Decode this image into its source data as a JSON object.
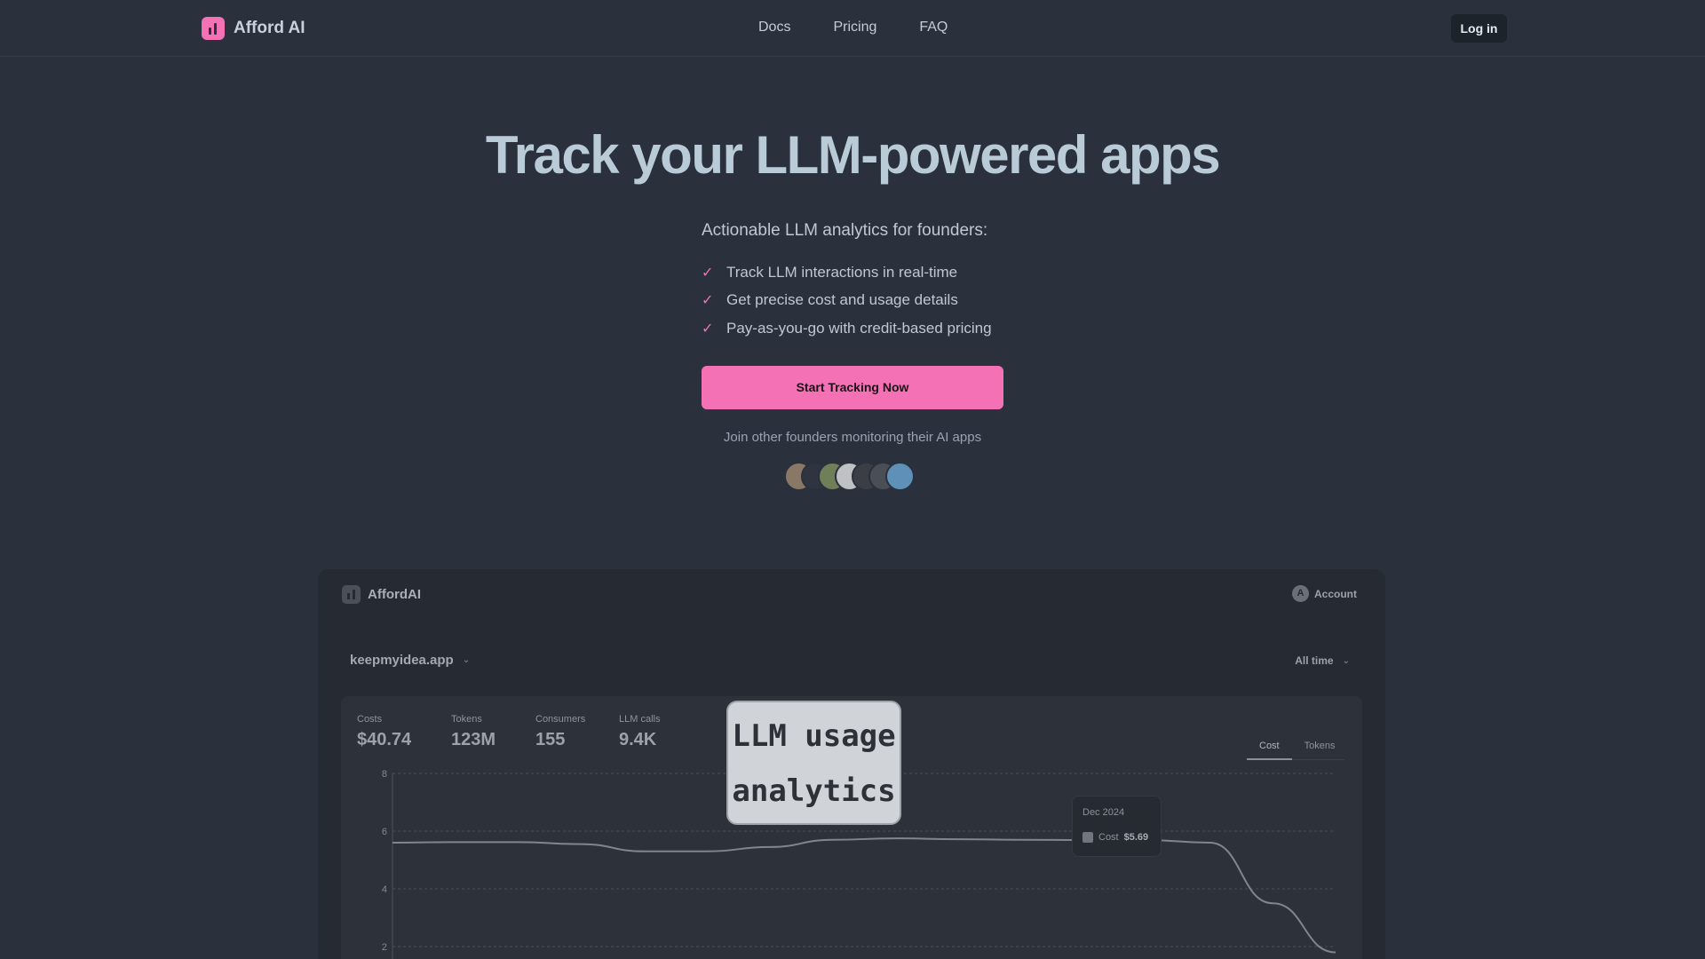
{
  "nav": {
    "brand": "Afford AI",
    "links": [
      "Docs",
      "Pricing",
      "FAQ"
    ],
    "login": "Log in"
  },
  "hero": {
    "title": "Track your LLM-powered apps",
    "subtitle": "Actionable LLM analytics for founders:",
    "features": [
      "Track LLM interactions in real-time",
      "Get precise cost and usage details",
      "Pay-as-you-go with credit-based pricing"
    ],
    "cta": "Start Tracking Now",
    "join_text": "Join other founders monitoring their AI apps",
    "avatar_colors": [
      "#8a7866",
      "#2f3440",
      "#6f7f58",
      "#bfc1c4",
      "#3b3f45",
      "#4a4e55",
      "#5f91b8"
    ]
  },
  "dashboard": {
    "brand": "AffordAI",
    "account": "Account",
    "account_initial": "A",
    "project": "keepmyidea.app",
    "time_range": "All time",
    "stats": [
      {
        "label": "Costs",
        "value": "$40.74"
      },
      {
        "label": "Tokens",
        "value": "123M"
      },
      {
        "label": "Consumers",
        "value": "155"
      },
      {
        "label": "LLM calls",
        "value": "9.4K"
      }
    ],
    "toggle": [
      "Cost",
      "Tokens"
    ],
    "overlay_lines": [
      "LLM usage",
      "analytics"
    ],
    "tooltip": {
      "date": "Dec 2024",
      "label": "Cost",
      "value": "$5.69"
    }
  },
  "chart_data": {
    "type": "line",
    "y_ticks": [
      8,
      6,
      4,
      2
    ],
    "ylim": [
      2,
      8
    ],
    "series": [
      {
        "values": [
          5.6,
          5.62,
          5.62,
          5.55,
          5.3,
          5.3,
          5.45,
          5.7,
          5.75,
          5.72,
          5.7,
          5.69,
          5.69,
          5.6,
          3.5,
          1.8
        ]
      }
    ],
    "grid": true
  }
}
